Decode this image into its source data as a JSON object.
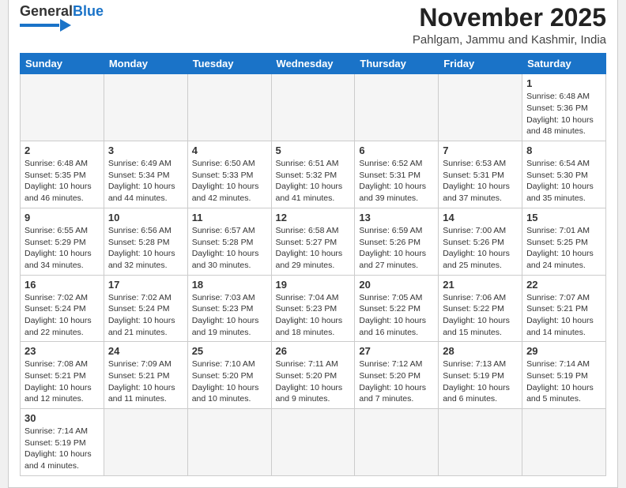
{
  "header": {
    "logo_general": "General",
    "logo_blue": "Blue",
    "month_title": "November 2025",
    "location": "Pahlgam, Jammu and Kashmir, India"
  },
  "days_of_week": [
    "Sunday",
    "Monday",
    "Tuesday",
    "Wednesday",
    "Thursday",
    "Friday",
    "Saturday"
  ],
  "weeks": [
    [
      {
        "day": "",
        "info": ""
      },
      {
        "day": "",
        "info": ""
      },
      {
        "day": "",
        "info": ""
      },
      {
        "day": "",
        "info": ""
      },
      {
        "day": "",
        "info": ""
      },
      {
        "day": "",
        "info": ""
      },
      {
        "day": "1",
        "info": "Sunrise: 6:48 AM\nSunset: 5:36 PM\nDaylight: 10 hours\nand 48 minutes."
      }
    ],
    [
      {
        "day": "2",
        "info": "Sunrise: 6:48 AM\nSunset: 5:35 PM\nDaylight: 10 hours\nand 46 minutes."
      },
      {
        "day": "3",
        "info": "Sunrise: 6:49 AM\nSunset: 5:34 PM\nDaylight: 10 hours\nand 44 minutes."
      },
      {
        "day": "4",
        "info": "Sunrise: 6:50 AM\nSunset: 5:33 PM\nDaylight: 10 hours\nand 42 minutes."
      },
      {
        "day": "5",
        "info": "Sunrise: 6:51 AM\nSunset: 5:32 PM\nDaylight: 10 hours\nand 41 minutes."
      },
      {
        "day": "6",
        "info": "Sunrise: 6:52 AM\nSunset: 5:31 PM\nDaylight: 10 hours\nand 39 minutes."
      },
      {
        "day": "7",
        "info": "Sunrise: 6:53 AM\nSunset: 5:31 PM\nDaylight: 10 hours\nand 37 minutes."
      },
      {
        "day": "8",
        "info": "Sunrise: 6:54 AM\nSunset: 5:30 PM\nDaylight: 10 hours\nand 35 minutes."
      }
    ],
    [
      {
        "day": "9",
        "info": "Sunrise: 6:55 AM\nSunset: 5:29 PM\nDaylight: 10 hours\nand 34 minutes."
      },
      {
        "day": "10",
        "info": "Sunrise: 6:56 AM\nSunset: 5:28 PM\nDaylight: 10 hours\nand 32 minutes."
      },
      {
        "day": "11",
        "info": "Sunrise: 6:57 AM\nSunset: 5:28 PM\nDaylight: 10 hours\nand 30 minutes."
      },
      {
        "day": "12",
        "info": "Sunrise: 6:58 AM\nSunset: 5:27 PM\nDaylight: 10 hours\nand 29 minutes."
      },
      {
        "day": "13",
        "info": "Sunrise: 6:59 AM\nSunset: 5:26 PM\nDaylight: 10 hours\nand 27 minutes."
      },
      {
        "day": "14",
        "info": "Sunrise: 7:00 AM\nSunset: 5:26 PM\nDaylight: 10 hours\nand 25 minutes."
      },
      {
        "day": "15",
        "info": "Sunrise: 7:01 AM\nSunset: 5:25 PM\nDaylight: 10 hours\nand 24 minutes."
      }
    ],
    [
      {
        "day": "16",
        "info": "Sunrise: 7:02 AM\nSunset: 5:24 PM\nDaylight: 10 hours\nand 22 minutes."
      },
      {
        "day": "17",
        "info": "Sunrise: 7:02 AM\nSunset: 5:24 PM\nDaylight: 10 hours\nand 21 minutes."
      },
      {
        "day": "18",
        "info": "Sunrise: 7:03 AM\nSunset: 5:23 PM\nDaylight: 10 hours\nand 19 minutes."
      },
      {
        "day": "19",
        "info": "Sunrise: 7:04 AM\nSunset: 5:23 PM\nDaylight: 10 hours\nand 18 minutes."
      },
      {
        "day": "20",
        "info": "Sunrise: 7:05 AM\nSunset: 5:22 PM\nDaylight: 10 hours\nand 16 minutes."
      },
      {
        "day": "21",
        "info": "Sunrise: 7:06 AM\nSunset: 5:22 PM\nDaylight: 10 hours\nand 15 minutes."
      },
      {
        "day": "22",
        "info": "Sunrise: 7:07 AM\nSunset: 5:21 PM\nDaylight: 10 hours\nand 14 minutes."
      }
    ],
    [
      {
        "day": "23",
        "info": "Sunrise: 7:08 AM\nSunset: 5:21 PM\nDaylight: 10 hours\nand 12 minutes."
      },
      {
        "day": "24",
        "info": "Sunrise: 7:09 AM\nSunset: 5:21 PM\nDaylight: 10 hours\nand 11 minutes."
      },
      {
        "day": "25",
        "info": "Sunrise: 7:10 AM\nSunset: 5:20 PM\nDaylight: 10 hours\nand 10 minutes."
      },
      {
        "day": "26",
        "info": "Sunrise: 7:11 AM\nSunset: 5:20 PM\nDaylight: 10 hours\nand 9 minutes."
      },
      {
        "day": "27",
        "info": "Sunrise: 7:12 AM\nSunset: 5:20 PM\nDaylight: 10 hours\nand 7 minutes."
      },
      {
        "day": "28",
        "info": "Sunrise: 7:13 AM\nSunset: 5:19 PM\nDaylight: 10 hours\nand 6 minutes."
      },
      {
        "day": "29",
        "info": "Sunrise: 7:14 AM\nSunset: 5:19 PM\nDaylight: 10 hours\nand 5 minutes."
      }
    ],
    [
      {
        "day": "30",
        "info": "Sunrise: 7:14 AM\nSunset: 5:19 PM\nDaylight: 10 hours\nand 4 minutes."
      },
      {
        "day": "",
        "info": ""
      },
      {
        "day": "",
        "info": ""
      },
      {
        "day": "",
        "info": ""
      },
      {
        "day": "",
        "info": ""
      },
      {
        "day": "",
        "info": ""
      },
      {
        "day": "",
        "info": ""
      }
    ]
  ]
}
